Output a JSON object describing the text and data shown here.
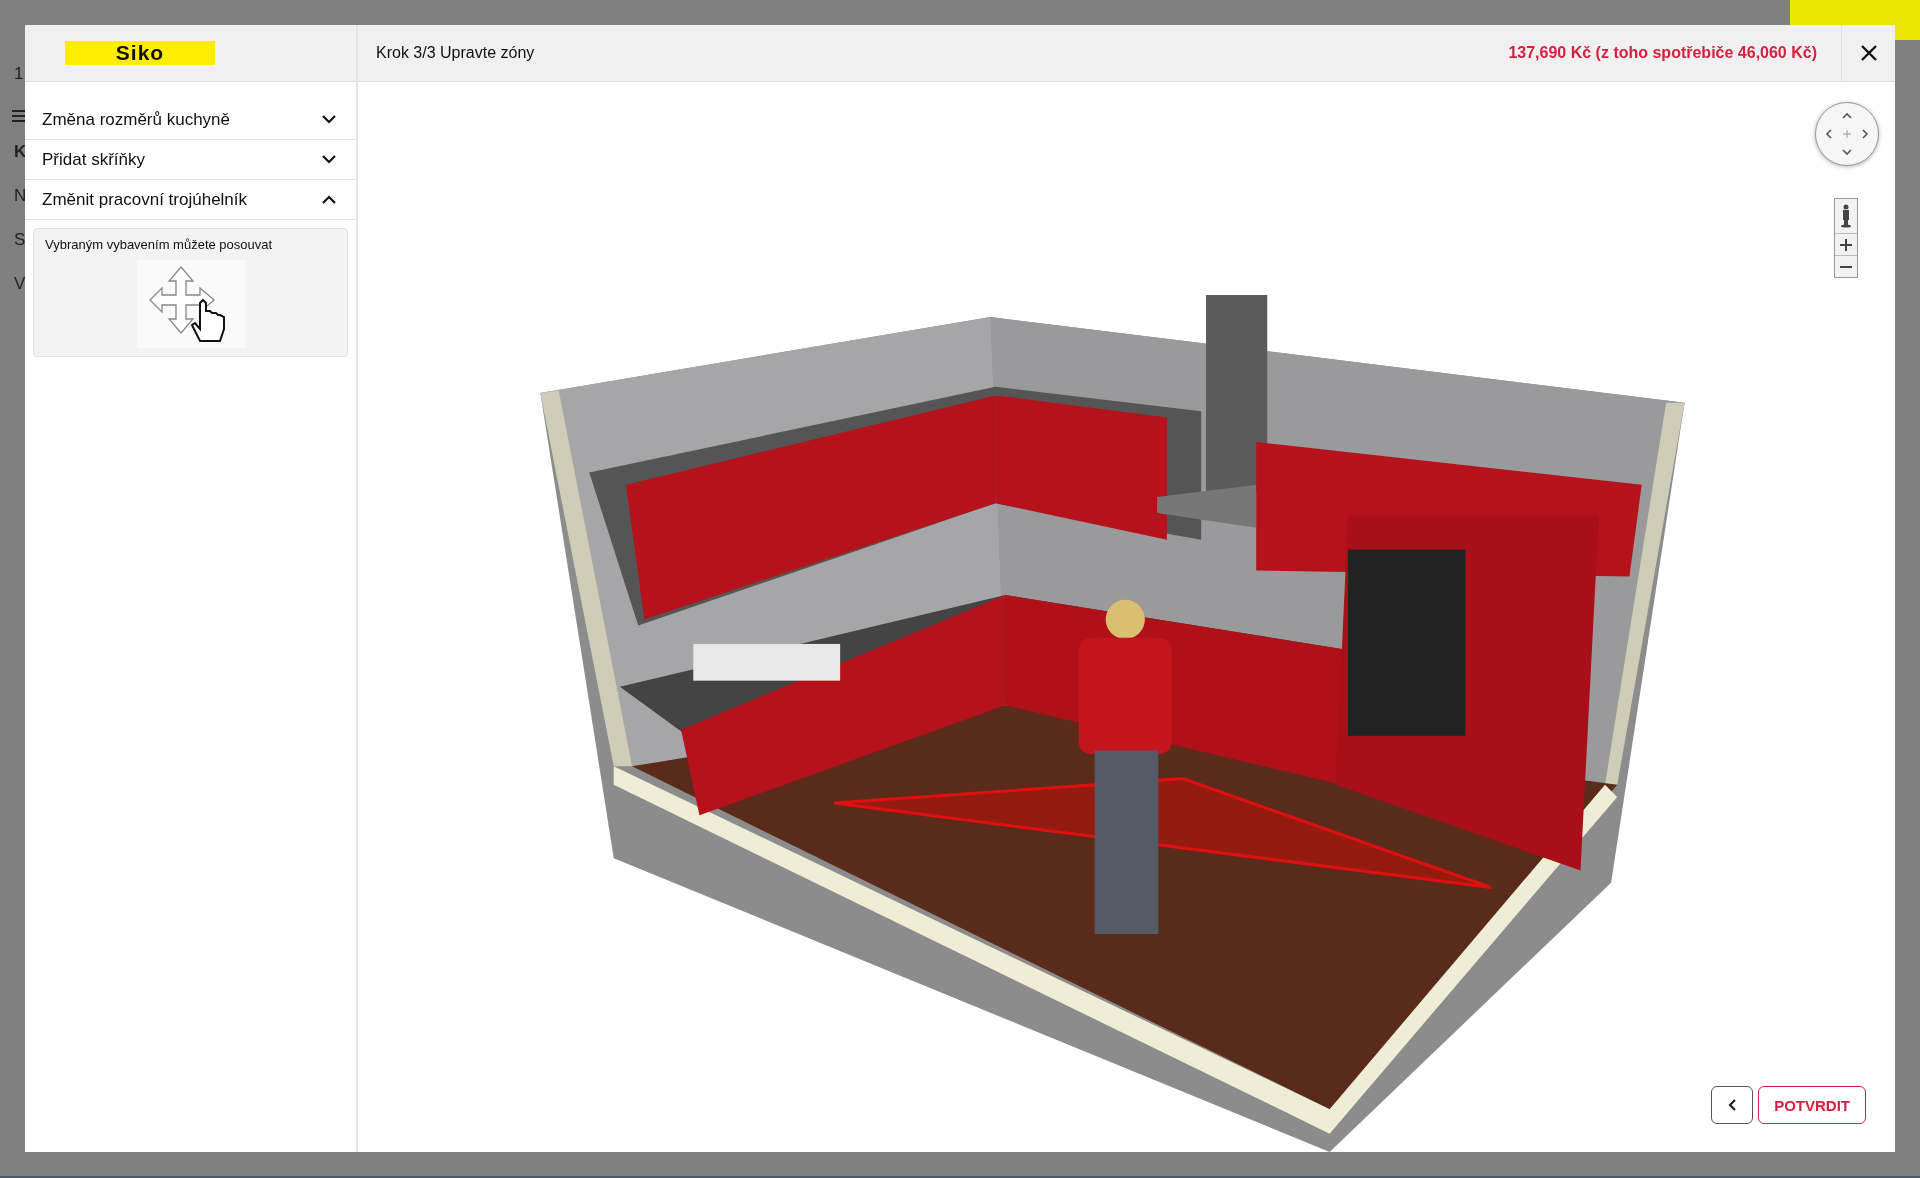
{
  "background": {
    "side_items": [
      "1",
      "K",
      "N",
      "S",
      "V"
    ]
  },
  "modal": {
    "logo": "Siko",
    "step_title": "Krok 3/3 Upravte zóny",
    "price": "137,690 Kč (z toho spotřebiče 46,060 Kč)",
    "sections": [
      {
        "label": "Změna rozměrů kuchyně",
        "expanded": false
      },
      {
        "label": "Přidat skříňky",
        "expanded": false
      },
      {
        "label": "Změnit pracovní trojúhelník",
        "expanded": true,
        "hint": "Vybraným vybavením můžete posouvat"
      }
    ],
    "confirm_button": "POTVRDIT"
  }
}
